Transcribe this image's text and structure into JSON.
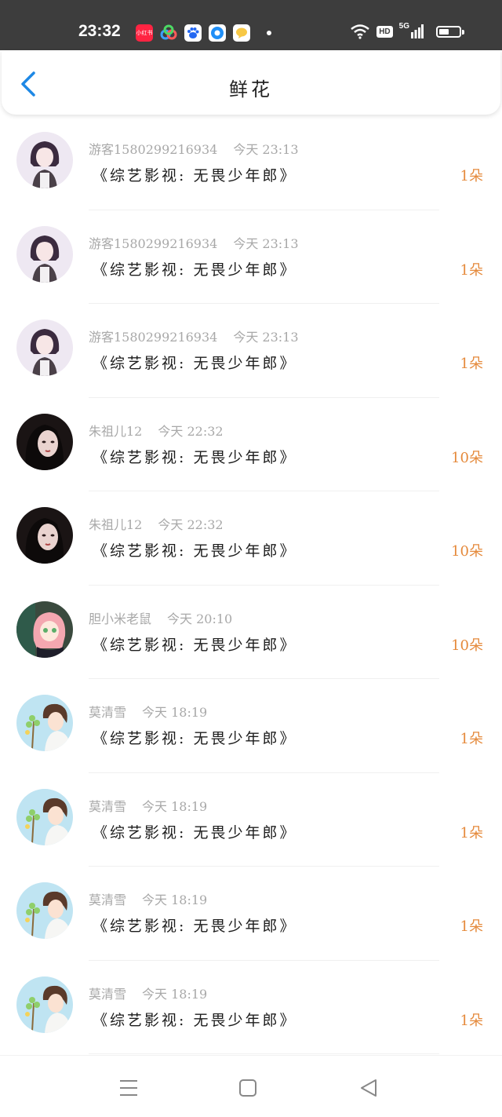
{
  "status": {
    "time": "23:32",
    "app_icons": [
      {
        "name": "xiaohongshu-icon",
        "label": "小红书",
        "color": "#ff2442"
      },
      {
        "name": "baidu-netdisk-icon",
        "label": "",
        "color": "#3d3d3d"
      },
      {
        "name": "baidu-icon",
        "label": "",
        "color": "#2468f2"
      },
      {
        "name": "browser-icon",
        "label": "",
        "color": "#1f8ff7"
      },
      {
        "name": "chat-icon",
        "label": "",
        "color": "#f7c846"
      }
    ],
    "hd": "HD",
    "network": "5G",
    "battery_level": 0.5
  },
  "header": {
    "title": "鲜花",
    "back_icon": "chevron-left-icon"
  },
  "colors": {
    "accent": "#1e88e5",
    "amount": "#e58a3c",
    "meta": "#a8a8a8"
  },
  "records": [
    {
      "user": "游客15802992169​34",
      "time": "今天 23:13",
      "work": "《综艺影视: 无畏少年郎》",
      "amount": "1朵",
      "avatar": "girl-short-hair"
    },
    {
      "user": "游客1580299216934",
      "time": "今天 23:13",
      "work": "《综艺影视: 无畏少年郎》",
      "amount": "1朵",
      "avatar": "girl-short-hair"
    },
    {
      "user": "游客1580299216934",
      "time": "今天 23:13",
      "work": "《综艺影视: 无畏少年郎》",
      "amount": "1朵",
      "avatar": "girl-short-hair"
    },
    {
      "user": "朱祖儿12",
      "time": "今天 22:32",
      "work": "《综艺影视: 无畏少年郎》",
      "amount": "10朵",
      "avatar": "girl-dark"
    },
    {
      "user": "朱祖儿12",
      "time": "今天 22:32",
      "work": "《综艺影视: 无畏少年郎》",
      "amount": "10朵",
      "avatar": "girl-dark"
    },
    {
      "user": "胆小米老鼠",
      "time": "今天 20:10",
      "work": "《综艺影视: 无畏少年郎》",
      "amount": "10朵",
      "avatar": "pink-hair-anime"
    },
    {
      "user": "莫清雪",
      "time": "今天 18:19",
      "work": "《综艺影视: 无畏少年郎》",
      "amount": "1朵",
      "avatar": "boy-plant"
    },
    {
      "user": "莫清雪",
      "time": "今天 18:19",
      "work": "《综艺影视: 无畏少年郎》",
      "amount": "1朵",
      "avatar": "boy-plant"
    },
    {
      "user": "莫清雪",
      "time": "今天 18:19",
      "work": "《综艺影视: 无畏少年郎》",
      "amount": "1朵",
      "avatar": "boy-plant"
    },
    {
      "user": "莫清雪",
      "time": "今天 18:19",
      "work": "《综艺影视: 无畏少年郎》",
      "amount": "1朵",
      "avatar": "boy-plant"
    }
  ],
  "nav": {
    "menu_icon": "menu-icon",
    "home_icon": "home-square-icon",
    "back_icon": "back-triangle-icon"
  }
}
